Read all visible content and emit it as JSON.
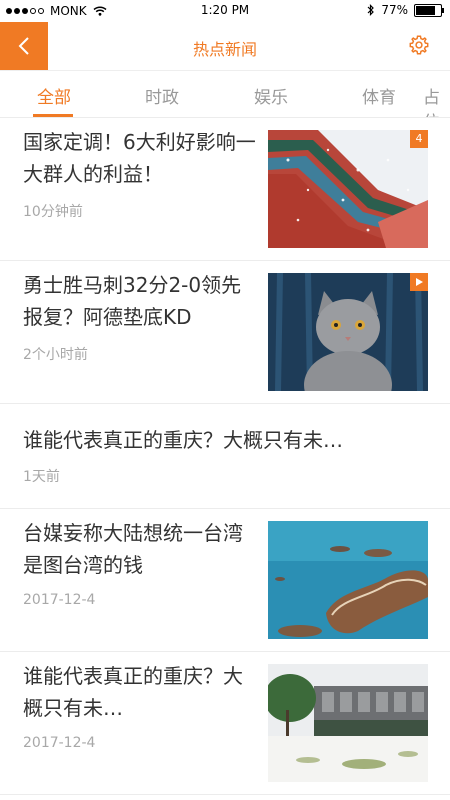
{
  "status_bar": {
    "carrier": "MONK",
    "time": "1:20 PM",
    "battery_percent": "77%"
  },
  "nav": {
    "title": "热点新闻",
    "back_icon": "chevron-left-icon",
    "settings_icon": "gear-icon",
    "accent_color": "#f07a24"
  },
  "tabs": [
    {
      "label": "全部",
      "active": true
    },
    {
      "label": "时政",
      "active": false
    },
    {
      "label": "娱乐",
      "active": false
    },
    {
      "label": "体育",
      "active": false
    },
    {
      "label": "占位",
      "active": false
    }
  ],
  "news": [
    {
      "title": "国家定调！6大利好影响一大群人的利益！",
      "time": "10分钟前",
      "thumb": "palace-roof-snow",
      "badge": "4"
    },
    {
      "title": "勇士胜马刺32分2-0领先报复？阿德垫底KD",
      "time": "2个小时前",
      "thumb": "gray-cat",
      "badge": "play-icon"
    },
    {
      "title": "谁能代表真正的重庆？大概只有未…",
      "time": "1天前"
    },
    {
      "title": "台媒妄称大陆想统一台湾是图台湾的钱",
      "time": "2017-12-4",
      "thumb": "islands-aerial"
    },
    {
      "title": "谁能代表真正的重庆？大概只有未…",
      "time": "2017-12-4",
      "thumb": "building-plaza"
    }
  ]
}
